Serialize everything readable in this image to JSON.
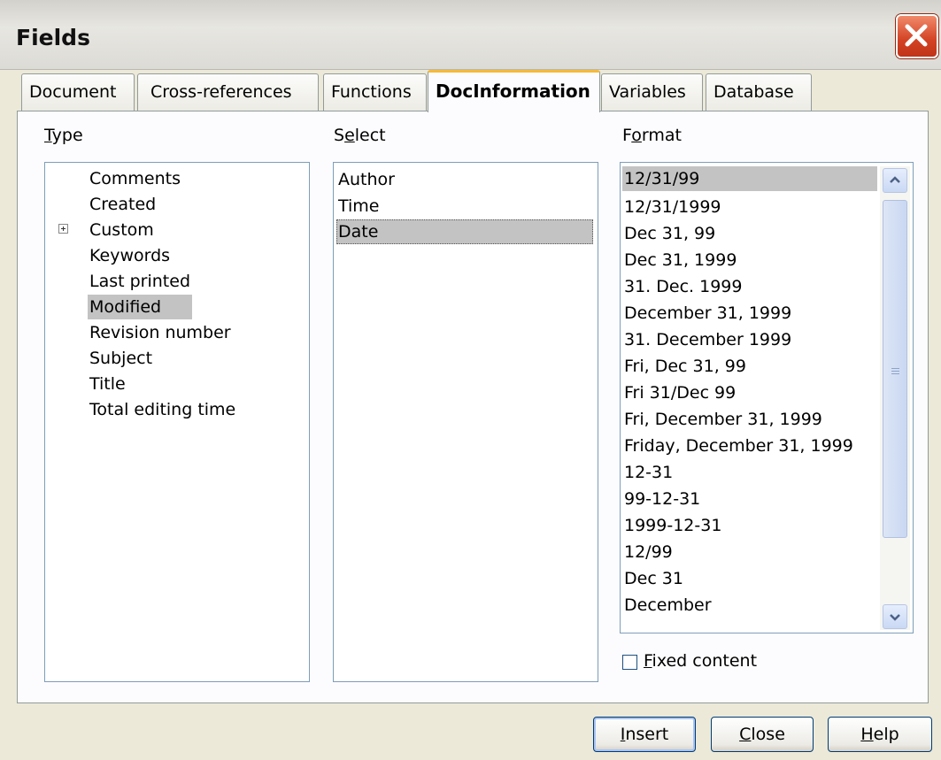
{
  "window": {
    "title": "Fields"
  },
  "tabs": [
    {
      "label": "Document"
    },
    {
      "label": "Cross-references"
    },
    {
      "label": "Functions"
    },
    {
      "label": "DocInformation",
      "active": true
    },
    {
      "label": "Variables"
    },
    {
      "label": "Database"
    }
  ],
  "type_panel": {
    "label_key": "T",
    "label_rest": "ype",
    "items": [
      {
        "label": "Comments"
      },
      {
        "label": "Created"
      },
      {
        "label": "Custom",
        "expandable": true
      },
      {
        "label": "Keywords"
      },
      {
        "label": "Last printed"
      },
      {
        "label": "Modified",
        "selected": true
      },
      {
        "label": "Revision number"
      },
      {
        "label": "Subject"
      },
      {
        "label": "Title"
      },
      {
        "label": "Total editing time"
      }
    ]
  },
  "select_panel": {
    "label_pre": "S",
    "label_key": "e",
    "label_rest": "lect",
    "items": [
      {
        "label": "Author"
      },
      {
        "label": "Time"
      },
      {
        "label": "Date",
        "selected": true
      }
    ]
  },
  "format_panel": {
    "label_pre": "F",
    "label_key": "o",
    "label_rest": "rmat",
    "items": [
      {
        "label": "12/31/99",
        "selected": true
      },
      {
        "label": "12/31/1999"
      },
      {
        "label": "Dec 31, 99"
      },
      {
        "label": "Dec 31, 1999"
      },
      {
        "label": "31. Dec. 1999"
      },
      {
        "label": "December 31, 1999"
      },
      {
        "label": "31. December 1999"
      },
      {
        "label": "Fri, Dec 31, 99"
      },
      {
        "label": "Fri 31/Dec 99"
      },
      {
        "label": "Fri, December 31, 1999"
      },
      {
        "label": "Friday, December 31, 1999"
      },
      {
        "label": "12-31"
      },
      {
        "label": "99-12-31"
      },
      {
        "label": "1999-12-31"
      },
      {
        "label": "12/99"
      },
      {
        "label": "Dec 31"
      },
      {
        "label": "December"
      }
    ]
  },
  "fixed_content": {
    "label_key": "F",
    "label_rest": "ixed content",
    "checked": false
  },
  "buttons": {
    "insert": {
      "key": "I",
      "rest": "nsert"
    },
    "close": {
      "key": "C",
      "rest": "lose"
    },
    "help": {
      "key": "H",
      "rest": "elp"
    }
  },
  "colors": {
    "dialog_bg": "#ece9d8",
    "selection": "#c3c3c3",
    "active_tab_accent": "#f6b93a",
    "close_button": "#d34224"
  }
}
